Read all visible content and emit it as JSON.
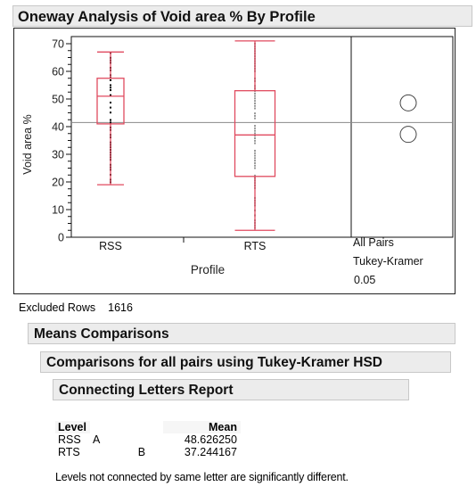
{
  "header": {
    "title": "Oneway Analysis of Void area % By Profile"
  },
  "chart_data": {
    "type": "box",
    "title": "Oneway Analysis of Void area % By Profile",
    "xlabel": "Profile",
    "ylabel": "Void area %",
    "ylim": [
      0,
      72
    ],
    "yticks": [
      0,
      10,
      20,
      30,
      40,
      50,
      60,
      70
    ],
    "categories": [
      "RSS",
      "RTS"
    ],
    "grand_mean": 41.5,
    "boxes": [
      {
        "name": "RSS",
        "whisker_low": 19,
        "q1": 41,
        "median": 51,
        "q3": 57.5,
        "whisker_high": 67,
        "point_color": "#000000"
      },
      {
        "name": "RTS",
        "whisker_low": 2.5,
        "q1": 22,
        "median": 37,
        "q3": 53,
        "whisker_high": 71,
        "point_color": "#999999"
      }
    ],
    "box_color": "#e04a5f",
    "comparison_circles": {
      "label_lines": [
        "All Pairs",
        "Tukey-Kramer",
        "0.05"
      ],
      "circles": [
        {
          "level": "RSS",
          "center": 48.6
        },
        {
          "level": "RTS",
          "center": 37.2
        }
      ]
    }
  },
  "excluded": {
    "label": "Excluded Rows",
    "value": "1616"
  },
  "sections": {
    "means": "Means Comparisons",
    "comparisons": "Comparisons for all pairs using Tukey-Kramer HSD",
    "connecting": "Connecting Letters Report"
  },
  "letters_report": {
    "headers": {
      "level": "Level",
      "mean": "Mean"
    },
    "rows": [
      {
        "level": "RSS",
        "letter_a": "A",
        "letter_b": "",
        "mean": "48.626250"
      },
      {
        "level": "RTS",
        "letter_a": "",
        "letter_b": "B",
        "mean": "37.244167"
      }
    ],
    "note": "Levels not connected by same letter are significantly different."
  }
}
